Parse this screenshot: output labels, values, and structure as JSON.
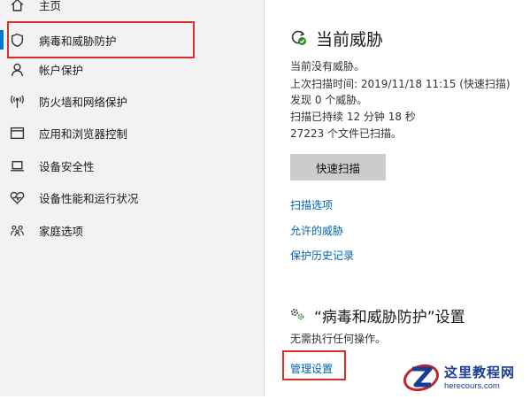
{
  "sidebar": {
    "items": [
      {
        "label": "主页",
        "icon": "home-icon"
      },
      {
        "label": "病毒和威胁防护",
        "icon": "shield-icon",
        "active": true
      },
      {
        "label": "帐户保护",
        "icon": "person-icon"
      },
      {
        "label": "防火墙和网络保护",
        "icon": "wifi-antenna-icon"
      },
      {
        "label": "应用和浏览器控制",
        "icon": "browser-window-icon"
      },
      {
        "label": "设备安全性",
        "icon": "laptop-icon"
      },
      {
        "label": "设备性能和运行状况",
        "icon": "heart-pulse-icon"
      },
      {
        "label": "家庭选项",
        "icon": "family-icon"
      }
    ]
  },
  "threats": {
    "title": "当前威胁",
    "icon": "refresh-check-icon",
    "lines": [
      "当前没有威胁。",
      "上次扫描时间: 2019/11/18 11:15 (快速扫描)",
      "发现 0 个威胁。",
      "扫描已持续 12 分钟 18 秒",
      "27223 个文件已扫描。"
    ],
    "scan_button": "快速扫描",
    "links": [
      "扫描选项",
      "允许的威胁",
      "保护历史记录"
    ]
  },
  "settings": {
    "title": "“病毒和威胁防护”设置",
    "icon": "gears-icon",
    "status": "无需执行任何操作。",
    "manage_link": "管理设置"
  },
  "watermark": {
    "name": "这里教程网",
    "url": "herecours.com"
  },
  "colors": {
    "accent": "#0078d7",
    "link": "#0063b1",
    "highlight": "#d9302c",
    "status_ok": "#2e8b2e"
  }
}
